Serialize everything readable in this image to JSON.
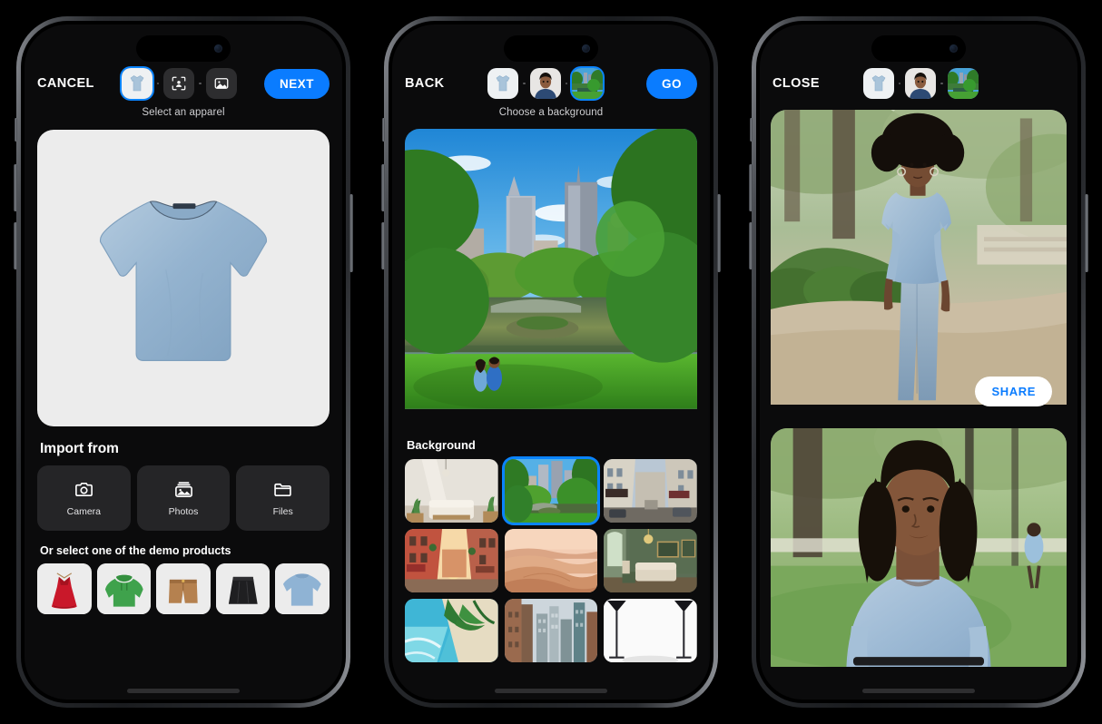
{
  "app": {
    "background_color": "#000000",
    "accent_color": "#0a7cff"
  },
  "phones": [
    {
      "id": "phone-select-apparel",
      "nav_label": "CANCEL",
      "action_label": "NEXT",
      "subtitle": "Select an apparel",
      "steps": [
        {
          "name": "apparel",
          "icon": "tshirt-thumbnail",
          "selected": true
        },
        {
          "name": "model",
          "icon": "person-scan-icon",
          "selected": false
        },
        {
          "name": "background",
          "icon": "image-icon",
          "selected": false
        }
      ],
      "hero": {
        "name": "blue-tshirt-preview",
        "alt": "Light blue crew neck t-shirt on light grey background"
      },
      "import": {
        "title": "Import from",
        "options": [
          {
            "label": "Camera",
            "icon": "camera-icon"
          },
          {
            "label": "Photos",
            "icon": "photos-icon"
          },
          {
            "label": "Files",
            "icon": "folder-icon"
          }
        ]
      },
      "demo": {
        "title": "Or select one of the demo products",
        "items": [
          {
            "name": "red-dress",
            "color": "#d02030"
          },
          {
            "name": "green-hoodie",
            "color": "#4aa552"
          },
          {
            "name": "tan-shorts",
            "color": "#b5814f"
          },
          {
            "name": "black-skirt",
            "color": "#2a2a2c"
          },
          {
            "name": "blue-tshirt",
            "color": "#8fb3d4"
          }
        ]
      }
    },
    {
      "id": "phone-choose-background",
      "nav_label": "BACK",
      "action_label": "GO",
      "subtitle": "Choose a background",
      "steps": [
        {
          "name": "apparel",
          "icon": "tshirt-thumbnail",
          "selected": false
        },
        {
          "name": "model",
          "icon": "model-portrait-thumbnail",
          "selected": false
        },
        {
          "name": "background",
          "icon": "park-thumbnail",
          "selected": true
        }
      ],
      "preview": {
        "name": "central-park-preview",
        "alt": "City park with lake, bridge, trees and skyline"
      },
      "section_title": "Background",
      "thumbnails": [
        {
          "name": "living-room-light",
          "selected": false
        },
        {
          "name": "city-park",
          "selected": true
        },
        {
          "name": "european-street",
          "selected": false
        },
        {
          "name": "italian-street-sunset",
          "selected": false
        },
        {
          "name": "desert-dunes",
          "selected": false
        },
        {
          "name": "green-living-room",
          "selected": false
        },
        {
          "name": "tropical-beach",
          "selected": false
        },
        {
          "name": "city-skyscrapers",
          "selected": false
        },
        {
          "name": "photo-studio-white",
          "selected": false
        }
      ]
    },
    {
      "id": "phone-result",
      "nav_label": "CLOSE",
      "action_label": "",
      "subtitle": "",
      "steps": [
        {
          "name": "apparel",
          "icon": "tshirt-thumbnail",
          "selected": false
        },
        {
          "name": "model",
          "icon": "model-portrait-thumbnail",
          "selected": false
        },
        {
          "name": "background",
          "icon": "park-thumbnail",
          "selected": false
        }
      ],
      "results": [
        {
          "name": "result-full-body",
          "alt": "Model in blue t-shirt and jeans on park path",
          "share_label": "SHARE"
        },
        {
          "name": "result-portrait",
          "alt": "Close-up of model in blue t-shirt in park"
        }
      ]
    }
  ]
}
